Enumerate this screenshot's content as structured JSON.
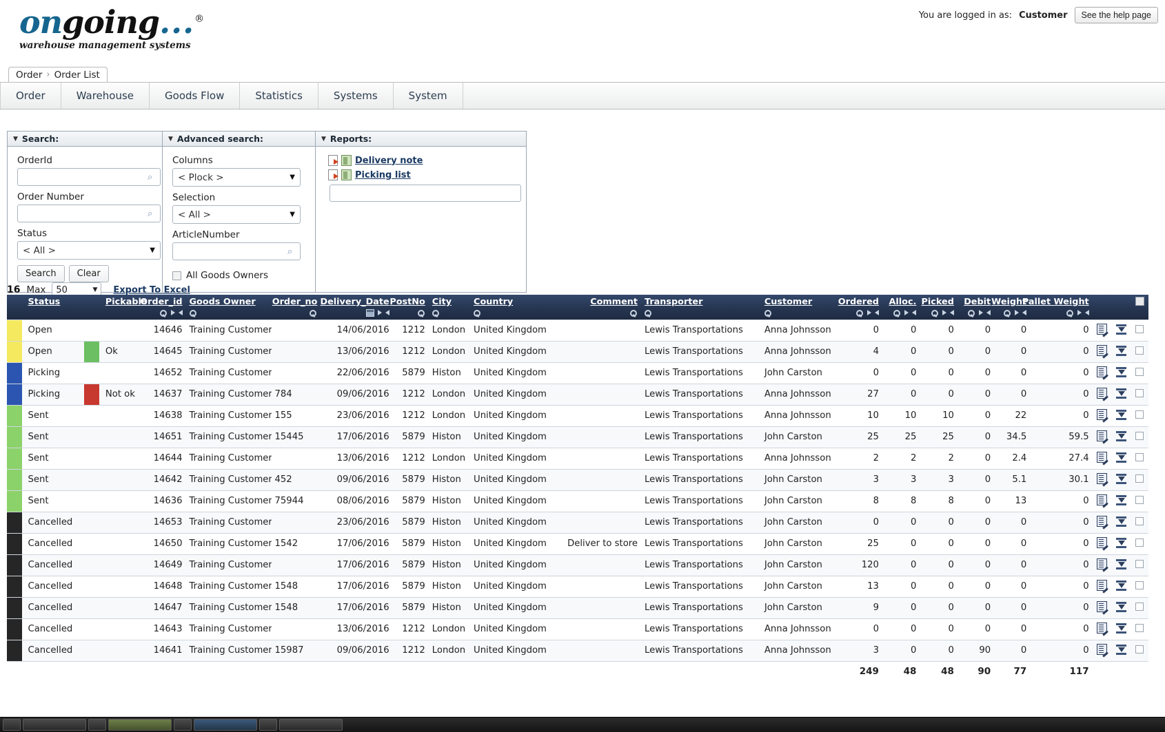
{
  "brand": {
    "name_on": "on",
    "name_going": "going",
    "dots": "...",
    "reg": "®",
    "tagline": "warehouse management systems"
  },
  "header": {
    "logged_in_prefix": "You are logged in as:",
    "logged_in_user": "Customer",
    "help_button": "See the help page"
  },
  "breadcrumb": {
    "root": "Order",
    "sep": "›",
    "current": "Order List"
  },
  "menu": {
    "items": [
      {
        "label": "Order"
      },
      {
        "label": "Warehouse"
      },
      {
        "label": "Goods Flow"
      },
      {
        "label": "Statistics"
      },
      {
        "label": "Systems"
      },
      {
        "label": "System"
      }
    ]
  },
  "search_panel": {
    "title": "Search:",
    "orderid_label": "OrderId",
    "orderid_value": "",
    "ordernumber_label": "Order Number",
    "ordernumber_value": "",
    "status_label": "Status",
    "status_value": "< All >",
    "search_button": "Search",
    "clear_button": "Clear"
  },
  "advanced_panel": {
    "title": "Advanced search:",
    "columns_label": "Columns",
    "columns_value": "< Plock >",
    "selection_label": "Selection",
    "selection_value": "< All >",
    "articlenumber_label": "ArticleNumber",
    "articlenumber_value": "",
    "all_goods_owners_label": "All Goods Owners",
    "all_goods_owners_checked": false
  },
  "reports_panel": {
    "title": "Reports:",
    "links": [
      {
        "label": "Delivery note"
      },
      {
        "label": "Picking list"
      }
    ],
    "input_value": ""
  },
  "results_toolbar": {
    "record_count": "16",
    "max_label": "Max",
    "max_value": "50",
    "export_label": "Export To Excel"
  },
  "table": {
    "columns": [
      {
        "key": "swatch",
        "label": "",
        "align": "left",
        "tools": []
      },
      {
        "key": "status",
        "label": "Status",
        "align": "left",
        "tools": []
      },
      {
        "key": "pickswatch",
        "label": "",
        "align": "left",
        "tools": []
      },
      {
        "key": "pickable",
        "label": "Pickable",
        "align": "left",
        "tools": []
      },
      {
        "key": "order_id",
        "label": "Order_id",
        "align": "right",
        "tools": [
          "key",
          "right",
          "left"
        ]
      },
      {
        "key": "goods_owner",
        "label": "Goods Owner",
        "align": "left",
        "tools": [
          "key"
        ]
      },
      {
        "key": "order_no",
        "label": "Order_no",
        "align": "right",
        "tools": [
          "key"
        ]
      },
      {
        "key": "delivery_date",
        "label": "Delivery_Date",
        "align": "right",
        "tools": [
          "cal",
          "right",
          "left"
        ]
      },
      {
        "key": "postno",
        "label": "PostNo",
        "align": "right",
        "tools": [
          "key"
        ]
      },
      {
        "key": "city",
        "label": "City",
        "align": "left",
        "tools": [
          "key"
        ]
      },
      {
        "key": "country",
        "label": "Country",
        "align": "left",
        "tools": [
          "key"
        ]
      },
      {
        "key": "comment",
        "label": "Comment",
        "align": "right",
        "tools": [
          "key"
        ]
      },
      {
        "key": "transporter",
        "label": "Transporter",
        "align": "left",
        "tools": [
          "key"
        ]
      },
      {
        "key": "customer",
        "label": "Customer",
        "align": "left",
        "tools": [
          "key"
        ]
      },
      {
        "key": "ordered",
        "label": "Ordered",
        "align": "right",
        "tools": [
          "key",
          "right",
          "left"
        ]
      },
      {
        "key": "alloc",
        "label": "Alloc.",
        "align": "right",
        "tools": [
          "key",
          "right",
          "left"
        ]
      },
      {
        "key": "picked",
        "label": "Picked",
        "align": "right",
        "tools": [
          "key",
          "right",
          "left"
        ]
      },
      {
        "key": "debit",
        "label": "Debit",
        "align": "right",
        "tools": [
          "key",
          "right",
          "left"
        ]
      },
      {
        "key": "weight",
        "label": "Weight",
        "align": "right",
        "tools": [
          "key",
          "right",
          "left"
        ]
      },
      {
        "key": "pallet_weight",
        "label": "Pallet Weight",
        "align": "right",
        "tools": [
          "key",
          "right",
          "left"
        ]
      }
    ],
    "status_colors": {
      "Open": "#f5ea5f",
      "Picking": "#2b55b0",
      "Sent": "#8cd26a",
      "Cancelled": "#262626"
    },
    "pickable_colors": {
      "Ok": "#6cbf63",
      "Not ok": "#c7382f"
    },
    "rows": [
      {
        "status": "Open",
        "pickable": "",
        "order_id": "14646",
        "goods_owner": "Training Customer",
        "order_no": "",
        "delivery_date": "14/06/2016",
        "postno": "1212",
        "city": "London",
        "country": "United Kingdom",
        "comment": "",
        "transporter": "Lewis Transportations",
        "customer": "Anna Johnsson",
        "ordered": "0",
        "alloc": "0",
        "picked": "0",
        "debit": "0",
        "weight": "0",
        "pallet_weight": "0"
      },
      {
        "status": "Open",
        "pickable": "Ok",
        "order_id": "14645",
        "goods_owner": "Training Customer",
        "order_no": "",
        "delivery_date": "13/06/2016",
        "postno": "1212",
        "city": "London",
        "country": "United Kingdom",
        "comment": "",
        "transporter": "Lewis Transportations",
        "customer": "Anna Johnsson",
        "ordered": "4",
        "alloc": "0",
        "picked": "0",
        "debit": "0",
        "weight": "0",
        "pallet_weight": "0"
      },
      {
        "status": "Picking",
        "pickable": "",
        "order_id": "14652",
        "goods_owner": "Training Customer",
        "order_no": "",
        "delivery_date": "22/06/2016",
        "postno": "5879",
        "city": "Histon",
        "country": "United Kingdom",
        "comment": "",
        "transporter": "Lewis Transportations",
        "customer": "John Carston",
        "ordered": "0",
        "alloc": "0",
        "picked": "0",
        "debit": "0",
        "weight": "0",
        "pallet_weight": "0"
      },
      {
        "status": "Picking",
        "pickable": "Not ok",
        "order_id": "14637",
        "goods_owner": "Training Customer",
        "order_no": "784",
        "delivery_date": "09/06/2016",
        "postno": "1212",
        "city": "London",
        "country": "United Kingdom",
        "comment": "",
        "transporter": "Lewis Transportations",
        "customer": "Anna Johnsson",
        "ordered": "27",
        "alloc": "0",
        "picked": "0",
        "debit": "0",
        "weight": "0",
        "pallet_weight": "0"
      },
      {
        "status": "Sent",
        "pickable": "",
        "order_id": "14638",
        "goods_owner": "Training Customer",
        "order_no": "155",
        "delivery_date": "23/06/2016",
        "postno": "1212",
        "city": "London",
        "country": "United Kingdom",
        "comment": "",
        "transporter": "Lewis Transportations",
        "customer": "Anna Johnsson",
        "ordered": "10",
        "alloc": "10",
        "picked": "10",
        "debit": "0",
        "weight": "22",
        "pallet_weight": "0"
      },
      {
        "status": "Sent",
        "pickable": "",
        "order_id": "14651",
        "goods_owner": "Training Customer",
        "order_no": "15445",
        "delivery_date": "17/06/2016",
        "postno": "5879",
        "city": "Histon",
        "country": "United Kingdom",
        "comment": "",
        "transporter": "Lewis Transportations",
        "customer": "John Carston",
        "ordered": "25",
        "alloc": "25",
        "picked": "25",
        "debit": "0",
        "weight": "34.5",
        "pallet_weight": "59.5"
      },
      {
        "status": "Sent",
        "pickable": "",
        "order_id": "14644",
        "goods_owner": "Training Customer",
        "order_no": "",
        "delivery_date": "13/06/2016",
        "postno": "1212",
        "city": "London",
        "country": "United Kingdom",
        "comment": "",
        "transporter": "Lewis Transportations",
        "customer": "Anna Johnsson",
        "ordered": "2",
        "alloc": "2",
        "picked": "2",
        "debit": "0",
        "weight": "2.4",
        "pallet_weight": "27.4"
      },
      {
        "status": "Sent",
        "pickable": "",
        "order_id": "14642",
        "goods_owner": "Training Customer",
        "order_no": "452",
        "delivery_date": "09/06/2016",
        "postno": "5879",
        "city": "Histon",
        "country": "United Kingdom",
        "comment": "",
        "transporter": "Lewis Transportations",
        "customer": "John Carston",
        "ordered": "3",
        "alloc": "3",
        "picked": "3",
        "debit": "0",
        "weight": "5.1",
        "pallet_weight": "30.1"
      },
      {
        "status": "Sent",
        "pickable": "",
        "order_id": "14636",
        "goods_owner": "Training Customer",
        "order_no": "75944",
        "delivery_date": "08/06/2016",
        "postno": "5879",
        "city": "Histon",
        "country": "United Kingdom",
        "comment": "",
        "transporter": "Lewis Transportations",
        "customer": "John Carston",
        "ordered": "8",
        "alloc": "8",
        "picked": "8",
        "debit": "0",
        "weight": "13",
        "pallet_weight": "0"
      },
      {
        "status": "Cancelled",
        "pickable": "",
        "order_id": "14653",
        "goods_owner": "Training Customer",
        "order_no": "",
        "delivery_date": "23/06/2016",
        "postno": "5879",
        "city": "Histon",
        "country": "United Kingdom",
        "comment": "",
        "transporter": "Lewis Transportations",
        "customer": "John Carston",
        "ordered": "0",
        "alloc": "0",
        "picked": "0",
        "debit": "0",
        "weight": "0",
        "pallet_weight": "0"
      },
      {
        "status": "Cancelled",
        "pickable": "",
        "order_id": "14650",
        "goods_owner": "Training Customer",
        "order_no": "1542",
        "delivery_date": "17/06/2016",
        "postno": "5879",
        "city": "Histon",
        "country": "United Kingdom",
        "comment": "Deliver to store",
        "transporter": "Lewis Transportations",
        "customer": "John Carston",
        "ordered": "25",
        "alloc": "0",
        "picked": "0",
        "debit": "0",
        "weight": "0",
        "pallet_weight": "0"
      },
      {
        "status": "Cancelled",
        "pickable": "",
        "order_id": "14649",
        "goods_owner": "Training Customer",
        "order_no": "",
        "delivery_date": "17/06/2016",
        "postno": "5879",
        "city": "Histon",
        "country": "United Kingdom",
        "comment": "",
        "transporter": "Lewis Transportations",
        "customer": "John Carston",
        "ordered": "120",
        "alloc": "0",
        "picked": "0",
        "debit": "0",
        "weight": "0",
        "pallet_weight": "0"
      },
      {
        "status": "Cancelled",
        "pickable": "",
        "order_id": "14648",
        "goods_owner": "Training Customer",
        "order_no": "1548",
        "delivery_date": "17/06/2016",
        "postno": "5879",
        "city": "Histon",
        "country": "United Kingdom",
        "comment": "",
        "transporter": "Lewis Transportations",
        "customer": "John Carston",
        "ordered": "13",
        "alloc": "0",
        "picked": "0",
        "debit": "0",
        "weight": "0",
        "pallet_weight": "0"
      },
      {
        "status": "Cancelled",
        "pickable": "",
        "order_id": "14647",
        "goods_owner": "Training Customer",
        "order_no": "1548",
        "delivery_date": "17/06/2016",
        "postno": "5879",
        "city": "Histon",
        "country": "United Kingdom",
        "comment": "",
        "transporter": "Lewis Transportations",
        "customer": "John Carston",
        "ordered": "9",
        "alloc": "0",
        "picked": "0",
        "debit": "0",
        "weight": "0",
        "pallet_weight": "0"
      },
      {
        "status": "Cancelled",
        "pickable": "",
        "order_id": "14643",
        "goods_owner": "Training Customer",
        "order_no": "",
        "delivery_date": "13/06/2016",
        "postno": "1212",
        "city": "London",
        "country": "United Kingdom",
        "comment": "",
        "transporter": "Lewis Transportations",
        "customer": "Anna Johnsson",
        "ordered": "0",
        "alloc": "0",
        "picked": "0",
        "debit": "0",
        "weight": "0",
        "pallet_weight": "0"
      },
      {
        "status": "Cancelled",
        "pickable": "",
        "order_id": "14641",
        "goods_owner": "Training Customer",
        "order_no": "15987",
        "delivery_date": "09/06/2016",
        "postno": "1212",
        "city": "London",
        "country": "United Kingdom",
        "comment": "",
        "transporter": "Lewis Transportations",
        "customer": "Anna Johnsson",
        "ordered": "3",
        "alloc": "0",
        "picked": "0",
        "debit": "90",
        "weight": "0",
        "pallet_weight": "0"
      }
    ],
    "totals": {
      "ordered": "249",
      "alloc": "48",
      "picked": "48",
      "debit": "90",
      "weight": "77",
      "pallet_weight": "117"
    }
  }
}
